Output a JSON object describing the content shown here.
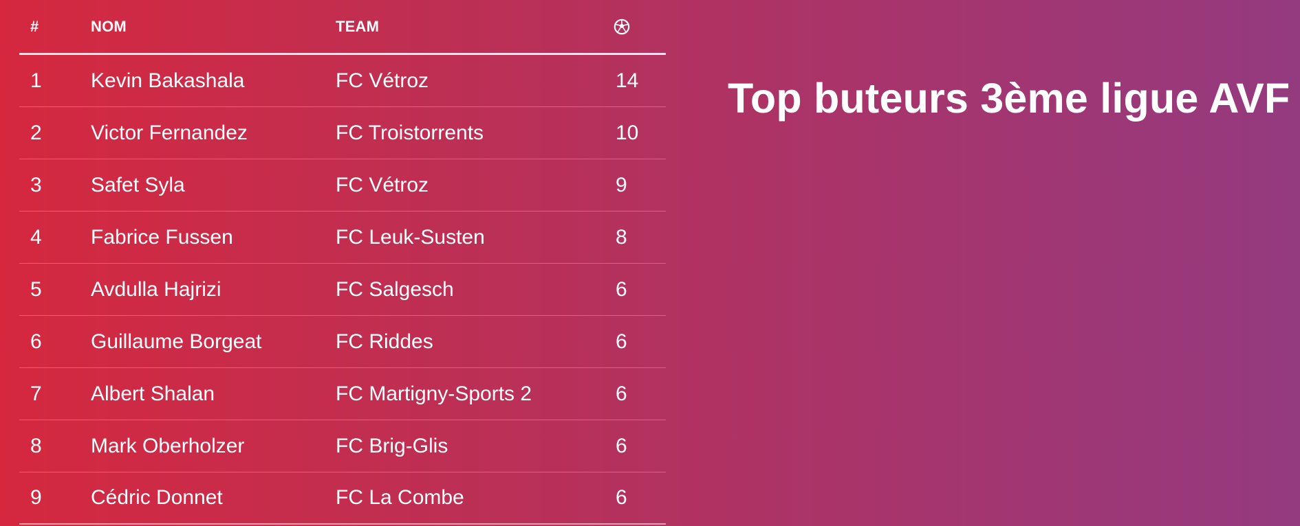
{
  "table": {
    "headers": {
      "rank": "#",
      "name": "NOM",
      "team": "TEAM",
      "goals_icon": "soccer-ball-icon"
    },
    "rows": [
      {
        "rank": "1",
        "name": "Kevin Bakashala",
        "team": "FC Vétroz",
        "goals": "14"
      },
      {
        "rank": "2",
        "name": "Victor Fernandez",
        "team": "FC Troistorrents",
        "goals": "10"
      },
      {
        "rank": "3",
        "name": "Safet Syla",
        "team": "FC Vétroz",
        "goals": "9"
      },
      {
        "rank": "4",
        "name": "Fabrice Fussen",
        "team": "FC Leuk-Susten",
        "goals": "8"
      },
      {
        "rank": "5",
        "name": "Avdulla Hajrizi",
        "team": "FC Salgesch",
        "goals": "6"
      },
      {
        "rank": "6",
        "name": "Guillaume Borgeat",
        "team": "FC Riddes",
        "goals": "6"
      },
      {
        "rank": "7",
        "name": "Albert Shalan",
        "team": "FC Martigny-Sports 2",
        "goals": "6"
      },
      {
        "rank": "8",
        "name": "Mark Oberholzer",
        "team": "FC Brig-Glis",
        "goals": "6"
      },
      {
        "rank": "9",
        "name": "Cédric Donnet",
        "team": "FC La Combe",
        "goals": "6"
      }
    ]
  },
  "title": "Top buteurs 3ème ligue AVF",
  "colors": {
    "background_start": "#d5283f",
    "background_end": "#943a7f",
    "text": "#ffffff"
  }
}
